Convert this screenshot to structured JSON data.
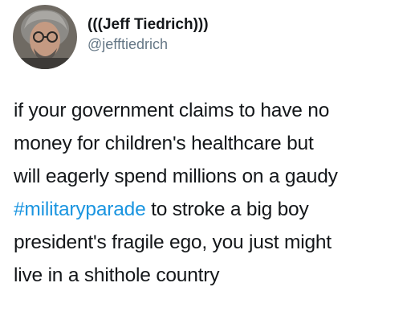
{
  "author": {
    "display_name": "(((Jeff Tiedrich)))",
    "handle": "@jefftiedrich",
    "avatar": "avatar-photo"
  },
  "tweet": {
    "line1": "if your government claims to have no",
    "line2": "money for children's healthcare but",
    "line3": "will eagerly spend millions on a gaudy",
    "line4_hashtag": "#militaryparade",
    "line4_rest": " to stroke a big boy",
    "line5": "president's fragile ego, you just might",
    "line6": "live in a shithole country"
  },
  "colors": {
    "text": "#14171a",
    "secondary": "#657786",
    "link": "#1b95e0",
    "background": "#ffffff"
  }
}
